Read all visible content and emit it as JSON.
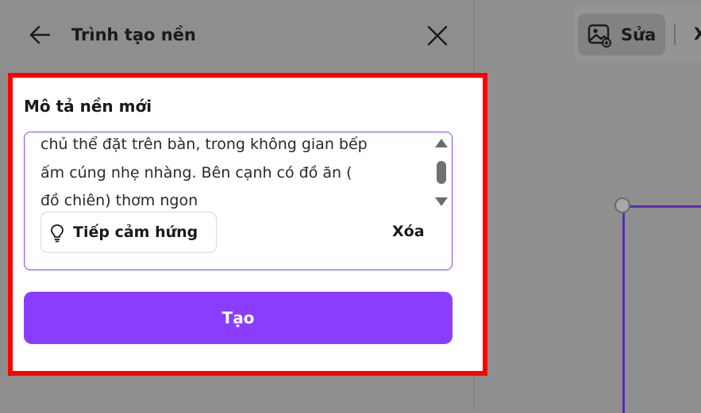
{
  "panel": {
    "title": "Trình tạo nền",
    "back_icon": "arrow-left-icon",
    "close_icon": "close-icon"
  },
  "form": {
    "description_label": "Mô tả nền mới",
    "prompt_lines": [
      "chủ thể đặt trên bàn, trong không gian bếp",
      "ấm cúng nhẹ nhàng. Bên cạnh có đồ ăn (",
      "đồ chiên) thơm ngon"
    ],
    "inspire_label": "Tiếp cảm hứng",
    "inspire_icon": "lightbulb-icon",
    "clear_label": "Xóa",
    "create_label": "Tạo"
  },
  "toolbar": {
    "edit_label": "Sửa",
    "edit_icon": "image-edit-icon",
    "next_label": "X"
  },
  "colors": {
    "accent": "#8b3dff",
    "highlight_border": "#ff0000",
    "overlay": "#8e8e8e",
    "frame": "#5b2bb3"
  }
}
